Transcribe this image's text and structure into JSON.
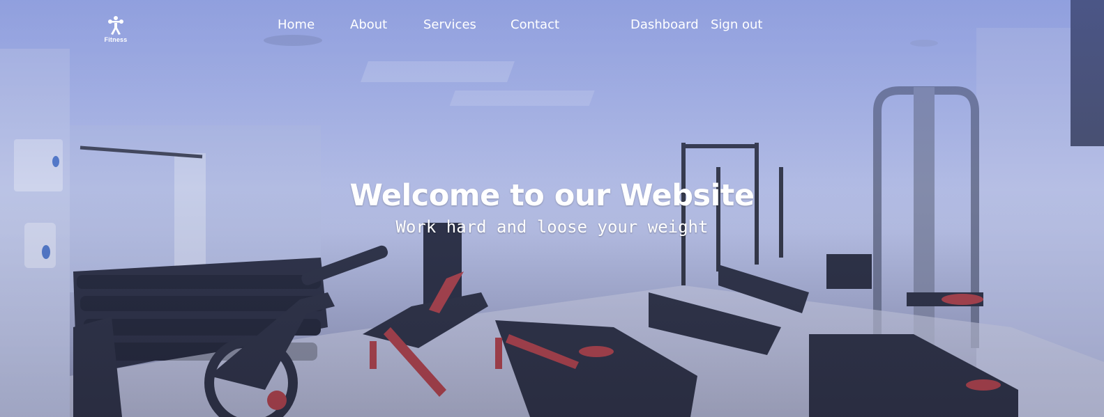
{
  "brand": {
    "logo_text": "Fitness",
    "logo_icon": "weightlifter-icon"
  },
  "nav": {
    "home": "Home",
    "about": "About",
    "services": "Services",
    "contact": "Contact",
    "dashboard": "Dashboard",
    "sign_out": "Sign out"
  },
  "hero": {
    "title": "Welcome to our Website",
    "subtitle": "Work hard and loose your weight"
  },
  "colors": {
    "overlay": "#6074cd",
    "text": "#ffffff"
  }
}
